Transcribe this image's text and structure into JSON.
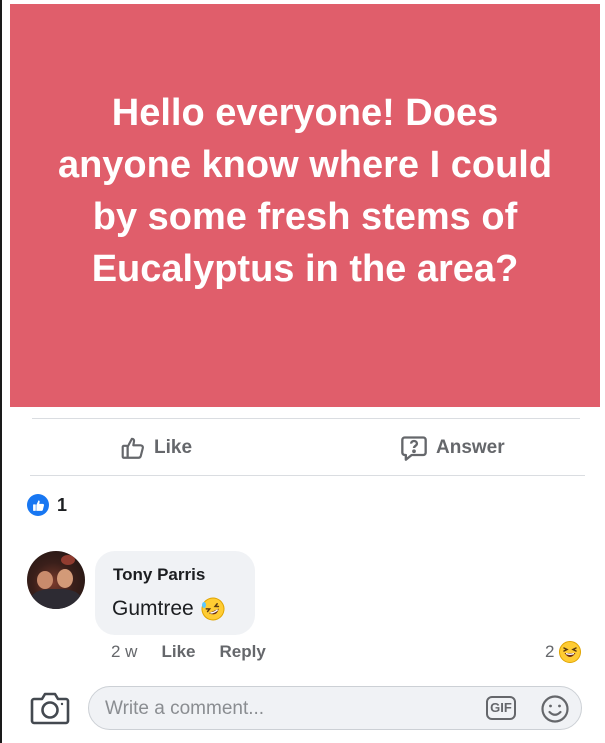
{
  "post": {
    "text": "Hello everyone! Does anyone know where I could by some fresh stems of Eucalyptus in the area?",
    "background_color": "#e05e6b"
  },
  "actions": {
    "like_label": "Like",
    "answer_label": "Answer"
  },
  "reactions": {
    "icon": "thumbs-up-icon",
    "count": "1"
  },
  "comment": {
    "author": "Tony Parris",
    "text": "Gumtree",
    "emoji": "rolling-laughing-emoji",
    "time": "2 w",
    "like_label": "Like",
    "reply_label": "Reply",
    "reaction_count": "2",
    "reaction_emoji": "laughing-emoji"
  },
  "composer": {
    "placeholder": "Write a comment...",
    "gif_label": "GIF"
  },
  "colors": {
    "accent_blue": "#1877f2",
    "meta_gray": "#65676b"
  }
}
